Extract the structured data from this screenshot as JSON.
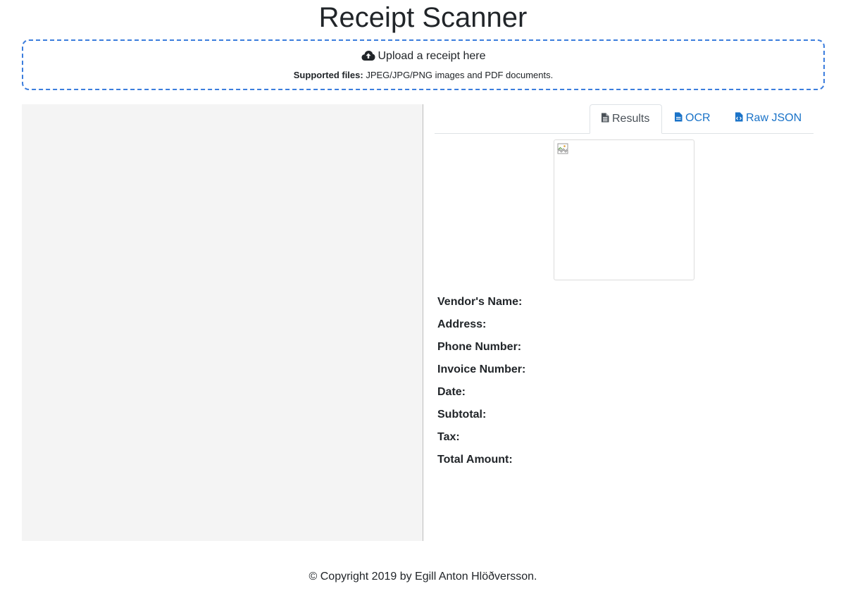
{
  "app": {
    "title": "Receipt Scanner"
  },
  "upload": {
    "label": "Upload a receipt here",
    "icon": "cloud-upload-icon",
    "supported_label": "Supported files:",
    "supported_text": " JPEG/JPG/PNG images and PDF documents."
  },
  "tabs": [
    {
      "label": "Results",
      "icon": "file-text-icon",
      "active": true
    },
    {
      "label": "OCR",
      "icon": "file-icon",
      "active": false
    },
    {
      "label": "Raw JSON",
      "icon": "file-code-icon",
      "active": false
    }
  ],
  "results": {
    "fields": [
      {
        "label": "Vendor's Name:",
        "value": ""
      },
      {
        "label": "Address:",
        "value": ""
      },
      {
        "label": "Phone Number:",
        "value": ""
      },
      {
        "label": "Invoice Number:",
        "value": ""
      },
      {
        "label": "Date:",
        "value": ""
      },
      {
        "label": "Subtotal:",
        "value": ""
      },
      {
        "label": "Tax:",
        "value": ""
      },
      {
        "label": "Total Amount:",
        "value": ""
      }
    ]
  },
  "footer": {
    "text": "© Copyright 2019 by Egill Anton Hlöðversson."
  },
  "colors": {
    "accent": "#1a73c8",
    "dropzone_border": "#3b7ddd",
    "preview_bg": "#f4f4f4"
  }
}
